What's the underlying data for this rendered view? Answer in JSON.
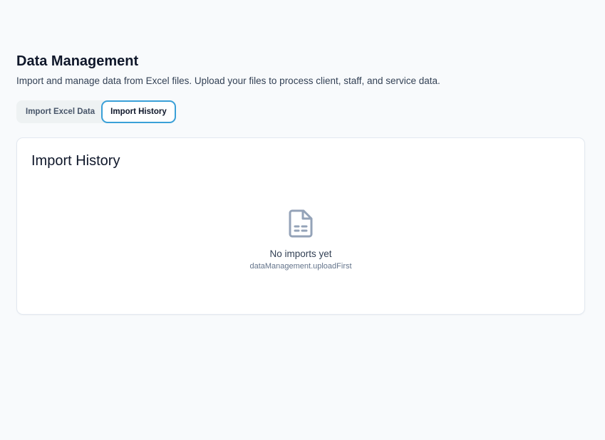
{
  "header": {
    "title": "Data Management",
    "subtitle": "Import and manage data from Excel files. Upload your files to process client, staff, and service data."
  },
  "tabs": [
    {
      "label": "Import Excel Data",
      "active": false
    },
    {
      "label": "Import History",
      "active": true
    }
  ],
  "card": {
    "title": "Import History",
    "empty_state": {
      "icon": "file-text-icon",
      "title": "No imports yet",
      "description": "dataManagement.uploadFirst"
    }
  },
  "colors": {
    "background": "#f8fafc",
    "accent": "#3aa0d8",
    "icon": "#94a3b8"
  }
}
